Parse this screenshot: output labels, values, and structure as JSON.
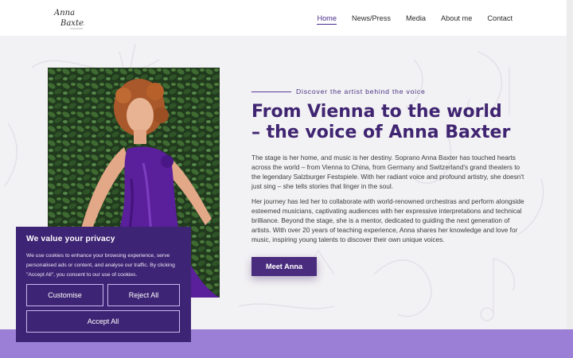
{
  "header": {
    "logo_alt": "Anna Baxter",
    "logo_lines": [
      "Anna",
      "Baxter"
    ],
    "nav": [
      {
        "label": "Home",
        "active": true
      },
      {
        "label": "News/Press",
        "active": false
      },
      {
        "label": "Media",
        "active": false
      },
      {
        "label": "About me",
        "active": false
      },
      {
        "label": "Contact",
        "active": false
      }
    ]
  },
  "hero": {
    "eyebrow": "Discover the artist behind the voice",
    "title": "From Vienna to the world – the voice of Anna Baxter",
    "paragraph_1": "The stage is her home, and music is her destiny. Soprano Anna Baxter has touched hearts across the world – from Vienna to China, from Germany and Switzerland's grand theaters to the legendary Salzburger Festspiele. With her radiant voice and profound artistry, she doesn't just sing – she tells stories that linger in the soul.",
    "paragraph_2": "Her journey has led her to collaborate with world-renowned orchestras and perform alongside esteemed musicians, captivating audiences with her expressive interpretations and technical brilliance. Beyond the stage, she is a mentor, dedicated to guiding the next generation of artists. With over 20 years of teaching experience, Anna shares her knowledge and love for music, inspiring young talents to discover their own unique voices.",
    "cta_label": "Meet Anna"
  },
  "cookie": {
    "title": "We value your privacy",
    "body": "We use cookies to enhance your browsing experience, serve personalised ads or content, and analyse our traffic. By clicking \"Accept All\", you consent to our use of cookies.",
    "customise_label": "Customise",
    "reject_label": "Reject All",
    "accept_label": "Accept All"
  },
  "colors": {
    "brand_purple": "#3f2471",
    "band_purple": "#9b7fd6",
    "cookie_bg": "#3e2474"
  }
}
